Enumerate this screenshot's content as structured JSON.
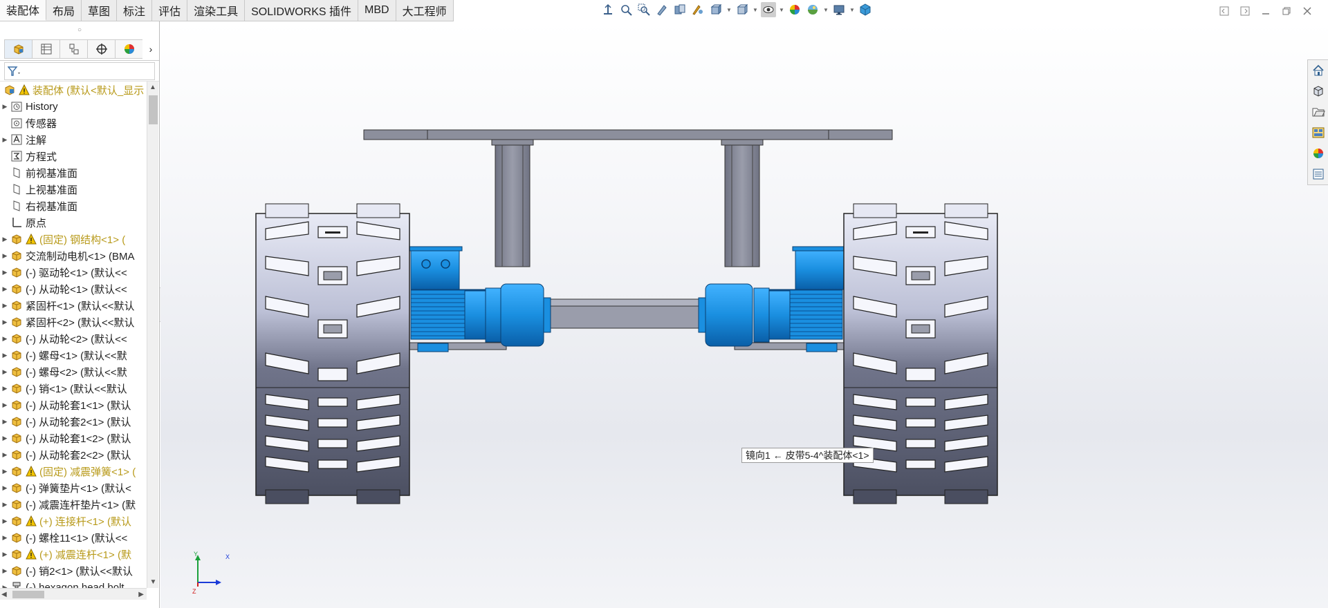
{
  "tabs": [
    {
      "label": "装配体",
      "active": true
    },
    {
      "label": "布局"
    },
    {
      "label": "草图"
    },
    {
      "label": "标注"
    },
    {
      "label": "评估"
    },
    {
      "label": "渲染工具"
    },
    {
      "label": "SOLIDWORKS 插件"
    },
    {
      "label": "MBD"
    },
    {
      "label": "大工程师"
    }
  ],
  "view_toolbar": [
    "normal-to-icon",
    "zoom-to-fit-icon",
    "zoom-to-area-icon",
    "previous-view-icon",
    "section-view-icon",
    "dynamic-annotation-icon",
    "view-orientation-icon",
    "display-style-icon",
    "hide-show-icon",
    "edit-appearance-icon",
    "apply-scene-icon",
    "view-settings-icon",
    "monitor-icon",
    "cube-icon"
  ],
  "feature_tree": {
    "root": "装配体 (默认<默认_显示",
    "items": [
      {
        "label": "History",
        "icon": "history-icon",
        "expandable": true
      },
      {
        "label": "传感器",
        "icon": "sensor-icon"
      },
      {
        "label": "注解",
        "icon": "annotation-icon",
        "expandable": true
      },
      {
        "label": "方程式",
        "icon": "equation-icon"
      },
      {
        "label": "前视基准面",
        "icon": "plane-icon"
      },
      {
        "label": "上视基准面",
        "icon": "plane-icon"
      },
      {
        "label": "右视基准面",
        "icon": "plane-icon"
      },
      {
        "label": "原点",
        "icon": "origin-icon"
      },
      {
        "label": "(固定) 钢结构<1> (",
        "icon": "assembly-icon",
        "expandable": true,
        "warning": true
      },
      {
        "label": "交流制动电机<1> (BMA",
        "icon": "assembly-icon",
        "expandable": true
      },
      {
        "label": "(-) 驱动轮<1> (默认<<",
        "icon": "assembly-icon",
        "expandable": true
      },
      {
        "label": "(-) 从动轮<1> (默认<<",
        "icon": "assembly-icon",
        "expandable": true
      },
      {
        "label": "紧固杆<1> (默认<<默认",
        "icon": "assembly-icon",
        "expandable": true
      },
      {
        "label": "紧固杆<2> (默认<<默认",
        "icon": "assembly-icon",
        "expandable": true
      },
      {
        "label": "(-) 从动轮<2> (默认<<",
        "icon": "assembly-icon",
        "expandable": true
      },
      {
        "label": "(-) 螺母<1> (默认<<默",
        "icon": "assembly-icon",
        "expandable": true
      },
      {
        "label": "(-) 螺母<2> (默认<<默",
        "icon": "assembly-icon",
        "expandable": true
      },
      {
        "label": "(-) 销<1> (默认<<默认",
        "icon": "assembly-icon",
        "expandable": true
      },
      {
        "label": "(-) 从动轮套1<1> (默认",
        "icon": "assembly-icon",
        "expandable": true
      },
      {
        "label": "(-) 从动轮套2<1> (默认",
        "icon": "assembly-icon",
        "expandable": true
      },
      {
        "label": "(-) 从动轮套1<2> (默认",
        "icon": "assembly-icon",
        "expandable": true
      },
      {
        "label": "(-) 从动轮套2<2> (默认",
        "icon": "assembly-icon",
        "expandable": true
      },
      {
        "label": "(固定) 减震弹簧<1> (",
        "icon": "assembly-icon",
        "expandable": true,
        "warning": true
      },
      {
        "label": "(-) 弹簧垫片<1> (默认<",
        "icon": "assembly-icon",
        "expandable": true
      },
      {
        "label": "(-) 减震连杆垫片<1> (默",
        "icon": "assembly-icon",
        "expandable": true
      },
      {
        "label": "(+) 连接杆<1> (默认",
        "icon": "assembly-icon",
        "expandable": true,
        "warning": true
      },
      {
        "label": "(-) 螺栓11<1> (默认<<",
        "icon": "assembly-icon",
        "expandable": true
      },
      {
        "label": "(+) 减震连杆<1> (默",
        "icon": "assembly-icon",
        "expandable": true,
        "warning": true
      },
      {
        "label": "(-) 销2<1> (默认<<默认",
        "icon": "assembly-icon",
        "expandable": true
      },
      {
        "label": "(-) hexagon head bolt",
        "icon": "bolt-icon",
        "expandable": true
      }
    ]
  },
  "tooltip": "镜向1 ← 皮带5-4^装配体<1>",
  "triad": {
    "x": "X",
    "y": "Y",
    "z": "Z"
  },
  "task_pane": [
    "home-icon",
    "design-library-icon",
    "file-explorer-icon",
    "view-palette-icon",
    "appearances-icon",
    "custom-properties-icon"
  ],
  "colors": {
    "accent_blue": "#1a8fe0",
    "frame_gray": "#7c7f8c",
    "warning_text": "#b89a1a"
  }
}
